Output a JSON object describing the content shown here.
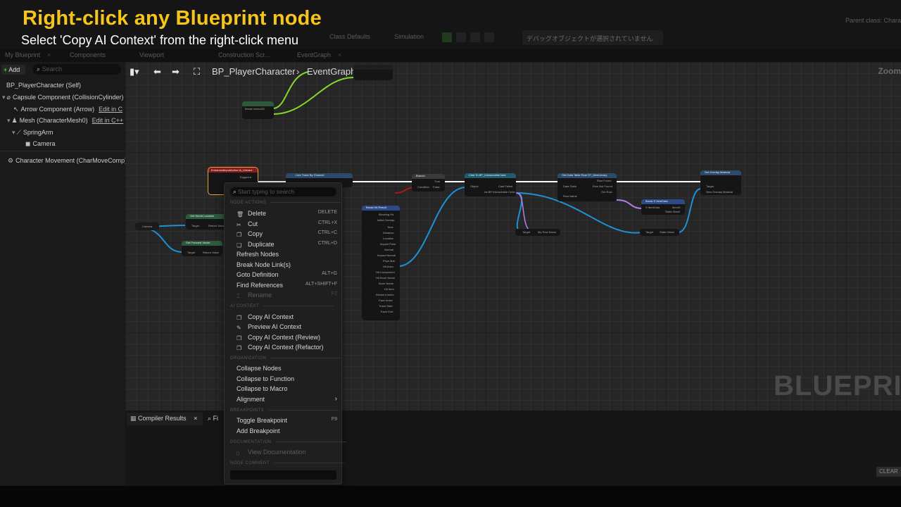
{
  "overlay": {
    "title": "Right-click any Blueprint node",
    "subtitle": "Select 'Copy AI Context' from the right-click menu"
  },
  "toolbar": {
    "class_defaults": "Class Defaults",
    "simulation": "Simulation",
    "debug_object": "デバッグオブジェクトが選択されていません",
    "parent_class": "Parent class: Chara"
  },
  "tabs": [
    "My Blueprint",
    "Components",
    "Viewport",
    "Construction Scr...",
    "EventGraph"
  ],
  "left_panel": {
    "add_label": "Add",
    "search_placeholder": "Search",
    "components": [
      {
        "label": "BP_PlayerCharacter (Self)"
      },
      {
        "label": "Capsule Component (CollisionCylinder)"
      },
      {
        "label": "Arrow Component (Arrow)",
        "edit": "Edit in C"
      },
      {
        "label": "Mesh (CharacterMesh0)",
        "edit": "Edit in C++"
      },
      {
        "label": "SpringArm"
      },
      {
        "label": "Camera"
      },
      {
        "label": "Character Movement (CharMoveComp)"
      }
    ]
  },
  "graph": {
    "breadcrumb": [
      "BP_PlayerCharacter",
      "EventGraph"
    ],
    "zoom": "Zoom",
    "watermark": "BLUEPRINT",
    "node_labels": {
      "branch": "Branch",
      "condition": "Condition",
      "true": "True",
      "false": "False",
      "camera": "Camera",
      "target": "Target",
      "object": "Object",
      "cast_failed": "Cast Failed",
      "row_found": "Row Found",
      "row_not_found": "Row Not Found",
      "row_name": "Row Name",
      "data_table": "Data Table",
      "out_row": "Out Row",
      "new_overlay_material": "New Overlay Material",
      "hit_actor": "Hit Actor",
      "blocking_hit": "Blocking Hit",
      "initial_overlap": "Initial Overlap",
      "time": "Time",
      "distance": "Distance",
      "location": "Location",
      "impact_point": "Impact Point",
      "normal": "Normal",
      "impact_normal": "Impact Normal",
      "phys_mat": "Phys Mat",
      "hit_component": "Hit Component",
      "hit_bone_name": "Hit Bone Name",
      "bone_name": "Bone Name",
      "hit_item": "Hit Item",
      "element_index": "Element Index",
      "face_index": "Face Index",
      "trace_start": "Trace Start",
      "trace_end": "Trace End",
      "return_value": "Return Value",
      "triggered": "Triggered",
      "get_world_location": "Get World Location",
      "get_forward_vector": "Get Forward Vector",
      "line_trace": "Line Trace By Channel",
      "break_hit_result": "Break Hit Result",
      "cast_to": "Cast To BP_InteractableCube",
      "as_bp": "As BP Interactable Cube",
      "get_data_table_row": "Get Data Table Row DT_ItemLibrary",
      "break_item_data": "Break S ItemData",
      "s_item_data": "S ItemData",
      "item_id": "ItemID",
      "static_mesh": "Static Mesh",
      "my_row_name": "My Row Name",
      "set_overlay_material": "Set Overlay Material",
      "enhanced_input": "EnhancedInputAction IA_Interact",
      "break_vector": "Break Vector2D"
    }
  },
  "context_menu": {
    "search_placeholder": "Start typing to search",
    "sections": {
      "node_actions": "NODE ACTIONS",
      "ai_context": "AI CONTEXT",
      "organization": "ORGANIZATION",
      "breakpoints": "BREAKPOINTS",
      "documentation": "DOCUMENTATION",
      "node_comment": "NODE COMMENT"
    },
    "items": {
      "delete": {
        "label": "Delete",
        "shortcut": "DELETE"
      },
      "cut": {
        "label": "Cut",
        "shortcut": "CTRL+X"
      },
      "copy": {
        "label": "Copy",
        "shortcut": "CTRL+C"
      },
      "duplicate": {
        "label": "Duplicate",
        "shortcut": "CTRL+D"
      },
      "refresh": {
        "label": "Refresh Nodes"
      },
      "break_links": {
        "label": "Break Node Link(s)"
      },
      "goto_def": {
        "label": "Goto Definition",
        "shortcut": "ALT+G"
      },
      "find_refs": {
        "label": "Find References",
        "shortcut": "ALT+SHIFT+F"
      },
      "rename": {
        "label": "Rename",
        "shortcut": "F2"
      },
      "copy_ai": {
        "label": "Copy AI Context"
      },
      "preview_ai": {
        "label": "Preview AI Context"
      },
      "copy_ai_review": {
        "label": "Copy AI Context (Review)"
      },
      "copy_ai_refactor": {
        "label": "Copy AI Context (Refactor)"
      },
      "collapse_nodes": {
        "label": "Collapse Nodes"
      },
      "collapse_fn": {
        "label": "Collapse to Function"
      },
      "collapse_macro": {
        "label": "Collapse to Macro"
      },
      "alignment": {
        "label": "Alignment"
      },
      "toggle_bp": {
        "label": "Toggle Breakpoint",
        "shortcut": "F9"
      },
      "add_bp": {
        "label": "Add Breakpoint"
      },
      "view_doc": {
        "label": "View Documentation"
      }
    }
  },
  "bottom_panel": {
    "compiler_tab": "Compiler Results",
    "find_tab": "Fi",
    "clear": "CLEAR"
  },
  "colors": {
    "title_yellow": "#f5c518",
    "exec_white": "#ffffff",
    "object_blue": "#1e90d6",
    "vector_green": "#86d92a",
    "bool_red": "#b01717",
    "struct_purple": "#b87ce8"
  }
}
